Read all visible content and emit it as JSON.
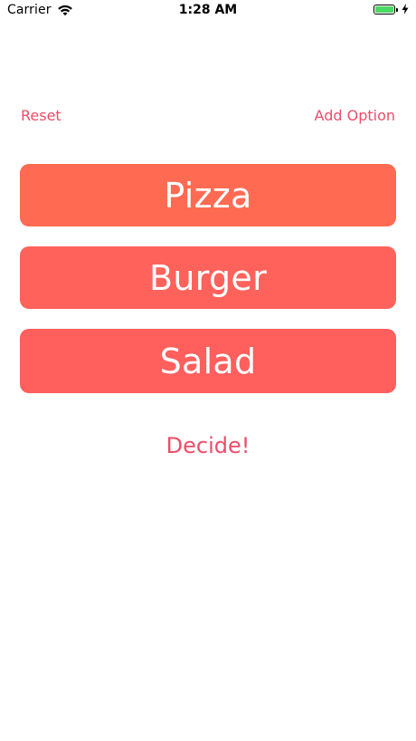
{
  "status_bar": {
    "carrier": "Carrier",
    "time": "1:28 AM",
    "wifi_icon": "wifi-icon",
    "battery_icon": "battery-icon",
    "charging_icon": "charging-bolt-icon",
    "battery_color": "#4cd964"
  },
  "toolbar": {
    "reset_label": "Reset",
    "add_option_label": "Add Option"
  },
  "options": [
    {
      "label": "Pizza",
      "color": "#ff6b52"
    },
    {
      "label": "Burger",
      "color": "#ff625b"
    },
    {
      "label": "Salad",
      "color": "#ff5f5d"
    }
  ],
  "decide_label": "Decide!",
  "accent_color": "#ec4e69"
}
